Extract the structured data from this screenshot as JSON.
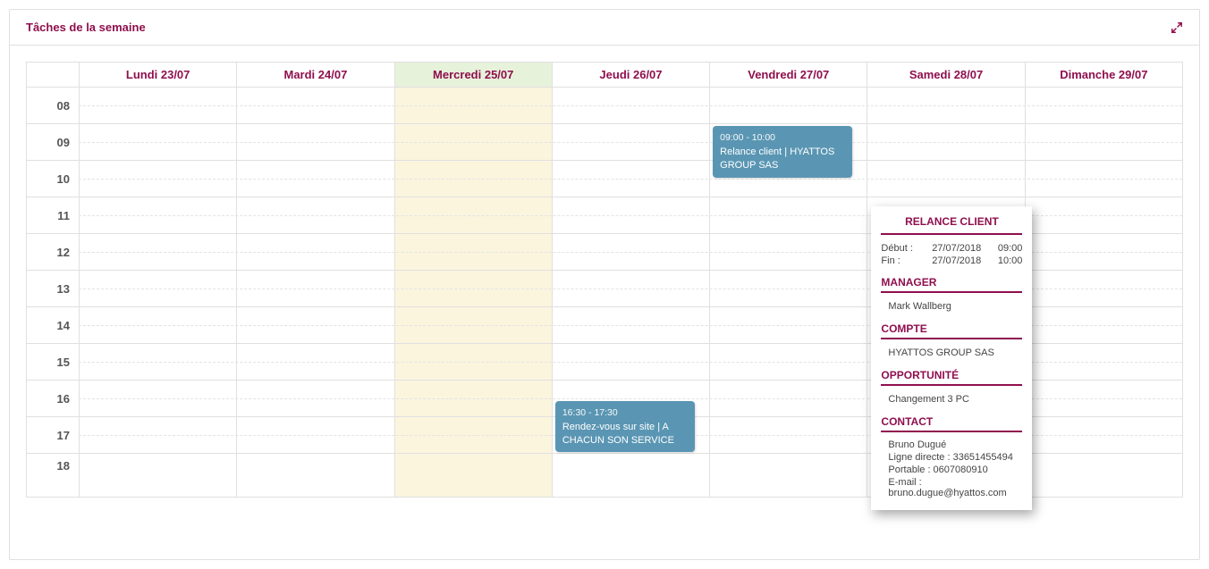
{
  "panel": {
    "title": "Tâches de la semaine"
  },
  "days": [
    {
      "label": "Lundi 23/07",
      "today": false
    },
    {
      "label": "Mardi 24/07",
      "today": false
    },
    {
      "label": "Mercredi 25/07",
      "today": true
    },
    {
      "label": "Jeudi 26/07",
      "today": false
    },
    {
      "label": "Vendredi 27/07",
      "today": false
    },
    {
      "label": "Samedi 28/07",
      "today": false
    },
    {
      "label": "Dimanche 29/07",
      "today": false
    }
  ],
  "hours": [
    "08",
    "09",
    "10",
    "11",
    "12",
    "13",
    "14",
    "15",
    "16",
    "17",
    "18"
  ],
  "events": [
    {
      "time": "09:00 - 10:00",
      "title": "Relance client | HYATTOS GROUP SAS",
      "day": 4,
      "startHour": 9,
      "rows": 1.5
    },
    {
      "time": "16:30 - 17:30",
      "title": "Rendez-vous sur site | A CHACUN SON SERVICE",
      "day": 3,
      "startHour": 16.5,
      "rows": 1.5
    }
  ],
  "popup": {
    "title": "RELANCE CLIENT",
    "start_label": "Début :",
    "start_date": "27/07/2018",
    "start_time": "09:00",
    "end_label": "Fin :",
    "end_date": "27/07/2018",
    "end_time": "10:00",
    "section_manager": "MANAGER",
    "manager": "Mark Wallberg",
    "section_account": "COMPTE",
    "account": "HYATTOS GROUP SAS",
    "section_opportunity": "OPPORTUNITÉ",
    "opportunity": "Changement 3 PC",
    "section_contact": "CONTACT",
    "contact_name": "Bruno Dugué",
    "contact_direct": "Ligne directe : 33651455494",
    "contact_mobile": "Portable : 0607080910",
    "contact_email": "E-mail : bruno.dugue@hyattos.com"
  }
}
